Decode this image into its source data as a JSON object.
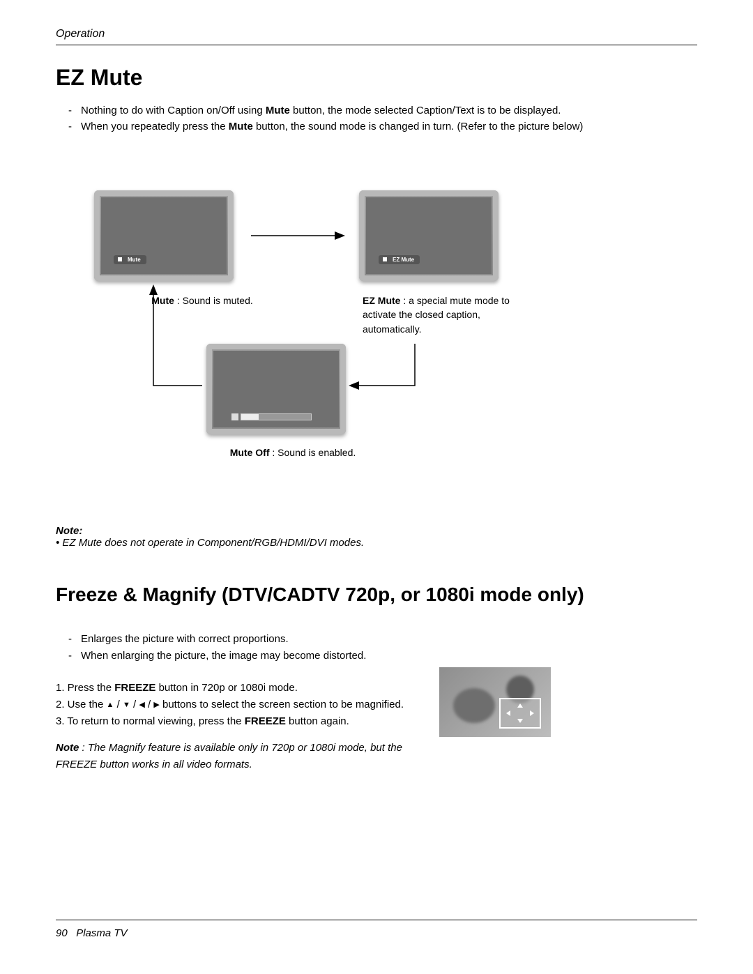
{
  "header": {
    "section": "Operation"
  },
  "ezmute": {
    "title": "EZ Mute",
    "bullets": [
      {
        "prefix": "Nothing to do with Caption on/Off using ",
        "bold1": "Mute",
        "rest": " button, the mode selected Caption/Text is to be displayed."
      },
      {
        "prefix": "When you repeatedly press the ",
        "bold1": "Mute",
        "rest": " button, the sound mode is changed in turn. (Refer to the picture below)"
      }
    ],
    "tv1": {
      "pill": "Mute",
      "caption_bold": "Mute",
      "caption_rest": " : Sound is muted."
    },
    "tv2": {
      "pill": "EZ Mute",
      "caption_bold": "EZ Mute",
      "caption_rest": " : a special mute mode to activate the closed caption, automatically."
    },
    "tv3": {
      "caption_bold": "Mute Off",
      "caption_rest": " : Sound is enabled."
    },
    "note": {
      "label": "Note: ",
      "bullet": "• EZ Mute does not operate in Component/RGB/HDMI/DVI modes."
    }
  },
  "freeze": {
    "title": "Freeze & Magnify (DTV/CADTV 720p, or 1080i mode only)",
    "bullets": [
      "Enlarges the picture with correct proportions.",
      "When enlarging the picture, the image may become distorted."
    ],
    "steps": {
      "s1_a": "1. Press the ",
      "s1_bold": "FREEZE",
      "s1_b": " button  in 720p or 1080i mode.",
      "s2_a": "2. Use the ",
      "s2_b": " buttons to select the screen section to be magnified.",
      "s3_a": "3. To return to normal viewing, press the ",
      "s3_bold": "FREEZE",
      "s3_b": " button again."
    },
    "note": {
      "label": "Note",
      "text": " : The Magnify feature is available only in 720p or 1080i mode, but the FREEZE button works in all video formats."
    }
  },
  "footer": {
    "page": "90",
    "product": "Plasma TV"
  }
}
